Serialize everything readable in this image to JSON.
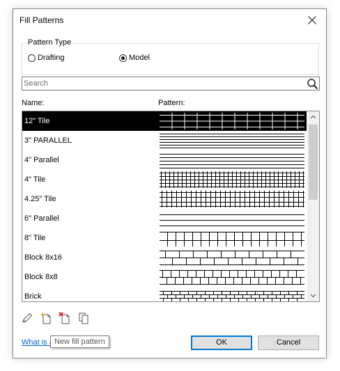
{
  "window": {
    "title": "Fill Patterns",
    "close_icon": "close-icon"
  },
  "pattern_type": {
    "label": "Pattern Type",
    "options": [
      {
        "label": "Drafting",
        "selected": false
      },
      {
        "label": "Model",
        "selected": true
      }
    ]
  },
  "search": {
    "placeholder": "Search",
    "value": "",
    "icon": "search-icon"
  },
  "list": {
    "columns": {
      "name": "Name:",
      "pattern": "Pattern:"
    },
    "rows": [
      {
        "name": "12\" Tile",
        "pattern": "tile-large",
        "selected": true
      },
      {
        "name": "3\" PARALLEL",
        "pattern": "parallel-dense",
        "selected": false
      },
      {
        "name": "4\" Parallel",
        "pattern": "parallel-medium",
        "selected": false
      },
      {
        "name": "4\" Tile",
        "pattern": "tile-dense",
        "selected": false
      },
      {
        "name": "4.25\" Tile",
        "pattern": "tile-medium",
        "selected": false
      },
      {
        "name": "6\" Parallel",
        "pattern": "parallel-wide",
        "selected": false
      },
      {
        "name": "8\" Tile",
        "pattern": "tile-wide",
        "selected": false
      },
      {
        "name": "Block 8x16",
        "pattern": "block-8x16",
        "selected": false
      },
      {
        "name": "Block 8x8",
        "pattern": "block-8x8",
        "selected": false
      },
      {
        "name": "Brick",
        "pattern": "brick",
        "selected": false
      }
    ],
    "scroll_position": 0
  },
  "toolbar": {
    "tools": [
      {
        "name": "edit-pattern",
        "icon": "pencil-icon"
      },
      {
        "name": "new-pattern",
        "icon": "new-pattern-icon"
      },
      {
        "name": "delete-pattern",
        "icon": "delete-pattern-icon"
      },
      {
        "name": "duplicate-pattern",
        "icon": "duplicate-icon"
      }
    ],
    "tooltip": "New fill pattern"
  },
  "footer": {
    "help_link": "What is a",
    "ok_label": "OK",
    "cancel_label": "Cancel"
  },
  "colors": {
    "selection_background": "#000000",
    "selection_text": "#ffffff",
    "link": "#0066cc",
    "default_button_border": "#0078d7"
  }
}
